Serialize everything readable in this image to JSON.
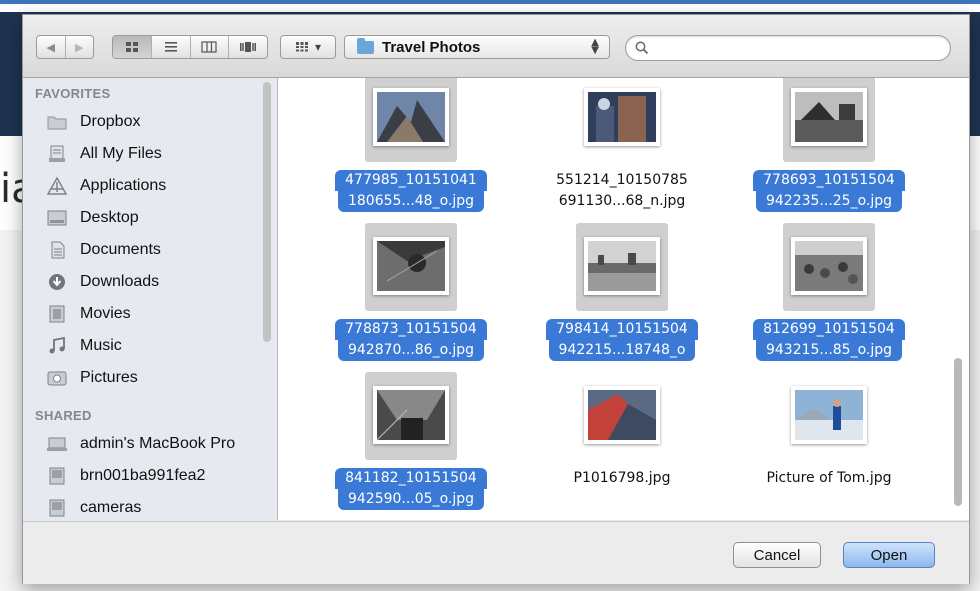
{
  "toolbar": {
    "back_glyph": "◀",
    "forward_glyph": "▶",
    "path_label": "Travel Photos",
    "path_stepper": "▲▼",
    "arrange_glyph": "▾",
    "search_placeholder": ""
  },
  "sidebar": {
    "favorites_header": "FAVORITES",
    "favorites": [
      {
        "label": "Dropbox",
        "icon": "folder-icon"
      },
      {
        "label": "All My Files",
        "icon": "all-files-icon"
      },
      {
        "label": "Applications",
        "icon": "applications-icon"
      },
      {
        "label": "Desktop",
        "icon": "desktop-icon"
      },
      {
        "label": "Documents",
        "icon": "documents-icon"
      },
      {
        "label": "Downloads",
        "icon": "downloads-icon"
      },
      {
        "label": "Movies",
        "icon": "movies-icon"
      },
      {
        "label": "Music",
        "icon": "music-icon"
      },
      {
        "label": "Pictures",
        "icon": "pictures-icon"
      }
    ],
    "shared_header": "SHARED",
    "shared": [
      {
        "label": "admin's MacBook Pro",
        "icon": "computer-icon"
      },
      {
        "label": "brn001ba991fea2",
        "icon": "network-device-icon"
      },
      {
        "label": "cameras",
        "icon": "network-device-icon"
      }
    ]
  },
  "files": [
    {
      "line1": "477985_10151041",
      "line2": "180655...48_o.jpg",
      "selected": true
    },
    {
      "line1": "551214_10150785",
      "line2": "691130...68_n.jpg",
      "selected": false
    },
    {
      "line1": "778693_10151504",
      "line2": "942235...25_o.jpg",
      "selected": true
    },
    {
      "line1": "778873_10151504",
      "line2": "942870...86_o.jpg",
      "selected": true
    },
    {
      "line1": "798414_10151504",
      "line2": "942215...18748_o",
      "selected": true
    },
    {
      "line1": "812699_10151504",
      "line2": "943215...85_o.jpg",
      "selected": true
    },
    {
      "line1": "841182_10151504",
      "line2": "942590...05_o.jpg",
      "selected": true
    },
    {
      "line1": "P1016798.jpg",
      "line2": "",
      "selected": false
    },
    {
      "line1": "Picture of Tom.jpg",
      "line2": "",
      "selected": false
    }
  ],
  "footer": {
    "cancel_label": "Cancel",
    "open_label": "Open"
  },
  "background": {
    "partial_letter": "ia"
  },
  "colors": {
    "selection": "#3a7ad6",
    "sidebar_bg": "#e6eaf0",
    "open_button": "#8db8ef",
    "background_band": "#1f3350"
  }
}
